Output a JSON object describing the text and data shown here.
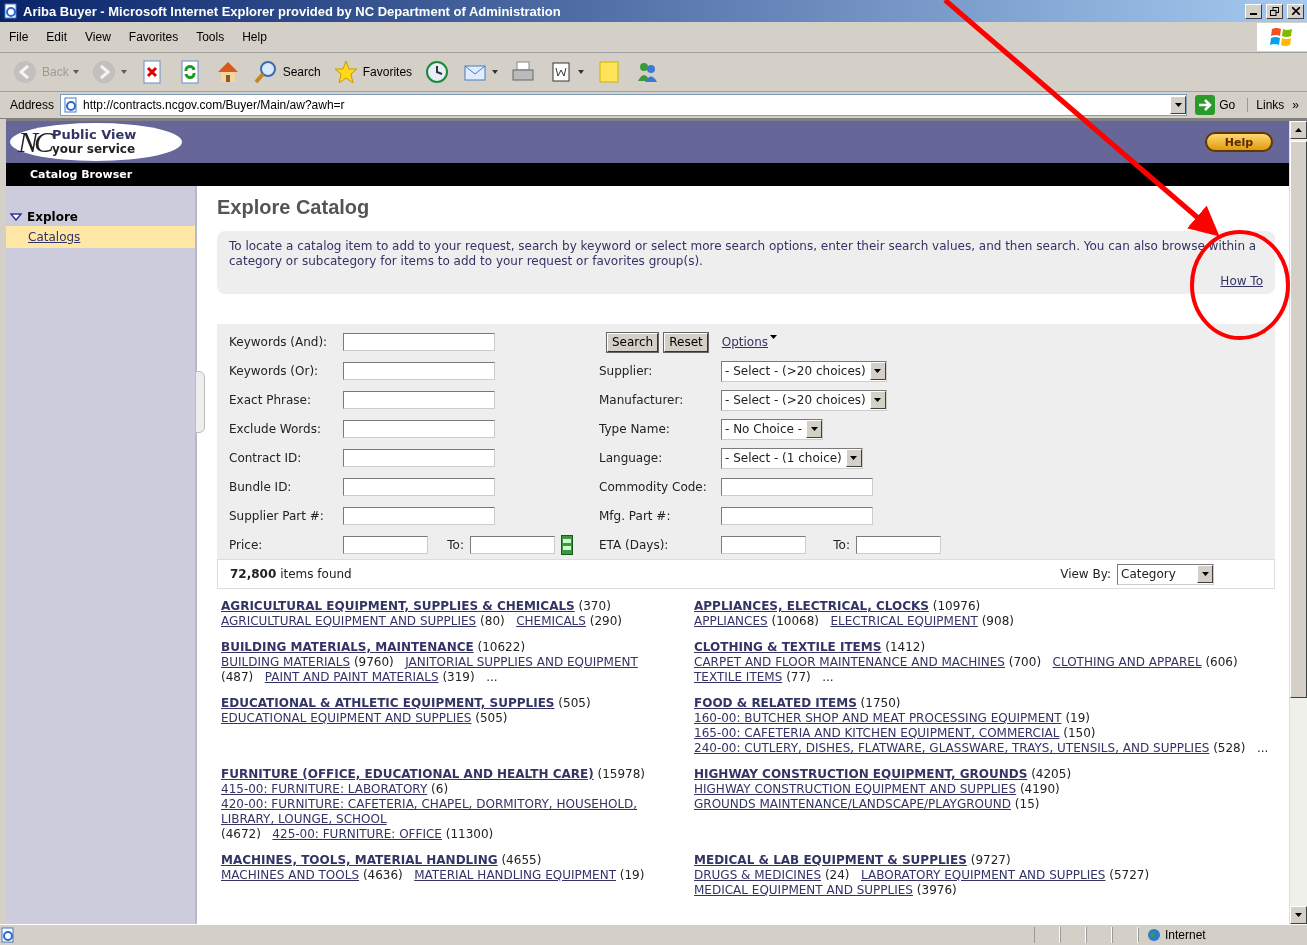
{
  "window": {
    "title": "Ariba Buyer - Microsoft Internet Explorer provided by NC Department of Administration"
  },
  "menu": [
    "File",
    "Edit",
    "View",
    "Favorites",
    "Tools",
    "Help"
  ],
  "toolbar": [
    {
      "kind": "back",
      "label": "Back",
      "disabled": true,
      "dropdown": true
    },
    {
      "kind": "forward",
      "disabled": true,
      "dropdown": true
    },
    {
      "kind": "stop",
      "disabled": false,
      "dropdown": false
    },
    {
      "kind": "refresh",
      "disabled": false,
      "dropdown": false
    },
    {
      "kind": "home",
      "disabled": false,
      "dropdown": false
    },
    {
      "kind": "search",
      "label": "Search",
      "disabled": false,
      "dropdown": false
    },
    {
      "kind": "favorites",
      "label": "Favorites",
      "disabled": false,
      "dropdown": false
    },
    {
      "kind": "history",
      "disabled": false,
      "dropdown": false
    },
    {
      "kind": "mail",
      "disabled": false,
      "dropdown": true
    },
    {
      "kind": "print",
      "disabled": false,
      "dropdown": false
    },
    {
      "kind": "edit",
      "disabled": false,
      "dropdown": true
    },
    {
      "kind": "note",
      "disabled": false,
      "dropdown": false
    },
    {
      "kind": "messenger",
      "disabled": false,
      "dropdown": false
    }
  ],
  "address": {
    "label": "Address",
    "url": "http://contracts.ncgov.com/Buyer/Main/aw?awh=r",
    "go": "Go",
    "links": "Links",
    "more": "»"
  },
  "header": {
    "logo_letters": "NC",
    "logo_title": "Public View",
    "logo_subtitle": "your service",
    "help": "Help",
    "nav_title": "Catalog Browser"
  },
  "sidebar": {
    "section": "Explore",
    "expanded": true,
    "items": [
      {
        "label": "Catalogs",
        "selected": true
      }
    ]
  },
  "main": {
    "title": "Explore Catalog",
    "intro": "To locate a catalog item to add to your request, search by keyword or select more search options, enter their search values, and then search. You can also browse within a category or subcategory for items to add to your request or favorites group(s).",
    "how_to": "How To"
  },
  "search": {
    "left": [
      {
        "label": "Keywords (And):"
      },
      {
        "label": "Keywords (Or):"
      },
      {
        "label": "Exact Phrase:"
      },
      {
        "label": "Exclude Words:"
      },
      {
        "label": "Contract ID:"
      },
      {
        "label": "Bundle ID:"
      },
      {
        "label": "Supplier Part #:"
      }
    ],
    "price": {
      "label": "Price:",
      "to": "To:"
    },
    "buttons": [
      "Search",
      "Reset"
    ],
    "options": "Options",
    "right": [
      {
        "kind": "select",
        "label": "Supplier:",
        "value": "- Select - (>20 choices)"
      },
      {
        "kind": "select",
        "label": "Manufacturer:",
        "value": "- Select - (>20 choices)"
      },
      {
        "kind": "select",
        "label": "Type Name:",
        "value": "- No Choice -"
      },
      {
        "kind": "select",
        "label": "Language:",
        "value": "- Select - (1 choice)"
      },
      {
        "kind": "text",
        "label": "Commodity Code:"
      },
      {
        "kind": "text",
        "label": "Mfg. Part #:"
      }
    ],
    "eta": {
      "label": "ETA (Days):",
      "to": "To:"
    }
  },
  "results": {
    "count": "72,800",
    "label": "items found",
    "view_by": "View By:",
    "view_value": "Category"
  },
  "categories": [
    {
      "title": "AGRICULTURAL EQUIPMENT, SUPPLIES & CHEMICALS",
      "count": "(370)",
      "subs": [
        {
          "label": "AGRICULTURAL EQUIPMENT AND SUPPLIES",
          "count": "(80)"
        },
        {
          "label": "CHEMICALS",
          "count": "(290)"
        }
      ]
    },
    {
      "title": "APPLIANCES, ELECTRICAL, CLOCKS",
      "count": "(10976)",
      "subs": [
        {
          "label": "APPLIANCES",
          "count": "(10068)"
        },
        {
          "label": "ELECTRICAL EQUIPMENT",
          "count": "(908)"
        }
      ]
    },
    {
      "title": "BUILDING MATERIALS, MAINTENANCE",
      "count": "(10622)",
      "more": "...",
      "subs": [
        {
          "label": "BUILDING MATERIALS",
          "count": "(9760)"
        },
        {
          "label": "JANITORIAL SUPPLIES AND EQUIPMENT",
          "count": "(487)"
        },
        {
          "label": "PAINT AND PAINT MATERIALS",
          "count": "(319)"
        }
      ]
    },
    {
      "title": "CLOTHING & TEXTILE ITEMS",
      "count": "(1412)",
      "more": "...",
      "subs": [
        {
          "label": "CARPET AND FLOOR MAINTENANCE AND MACHINES",
          "count": "(700)"
        },
        {
          "label": "CLOTHING AND APPAREL",
          "count": "(606)"
        },
        {
          "label": "TEXTILE ITEMS",
          "count": "(77)"
        }
      ]
    },
    {
      "title": "EDUCATIONAL & ATHLETIC EQUIPMENT, SUPPLIES",
      "count": "(505)",
      "subs": [
        {
          "label": "EDUCATIONAL EQUIPMENT AND SUPPLIES",
          "count": "(505)"
        }
      ]
    },
    {
      "title": "FOOD & RELATED ITEMS",
      "count": "(1750)",
      "more": "...",
      "subs": [
        {
          "label": "160-00: BUTCHER SHOP AND MEAT PROCESSING EQUIPMENT",
          "count": "(19)"
        },
        {
          "label": "165-00: CAFETERIA AND KITCHEN EQUIPMENT, COMMERCIAL",
          "count": "(150)"
        },
        {
          "label": "240-00: CUTLERY, DISHES, FLATWARE, GLASSWARE, TRAYS, UTENSILS, AND SUPPLIES",
          "count": "(528)"
        }
      ]
    },
    {
      "title": "FURNITURE (OFFICE, EDUCATIONAL AND HEALTH CARE)",
      "count": "(15978)",
      "subs": [
        {
          "label": "415-00: FURNITURE: LABORATORY",
          "count": "(6)"
        },
        {
          "label": "420-00: FURNITURE: CAFETERIA, CHAPEL, DORMITORY, HOUSEHOLD, LIBRARY, LOUNGE, SCHOOL",
          "count": "(4672)"
        },
        {
          "label": "425-00: FURNITURE: OFFICE",
          "count": "(11300)"
        }
      ]
    },
    {
      "title": "HIGHWAY CONSTRUCTION EQUIPMENT, GROUNDS",
      "count": "(4205)",
      "subs": [
        {
          "label": "HIGHWAY CONSTRUCTION EQUIPMENT AND SUPPLIES",
          "count": "(4190)"
        },
        {
          "label": "GROUNDS MAINTENANCE/LANDSCAPE/PLAYGROUND",
          "count": "(15)"
        }
      ]
    },
    {
      "title": "MACHINES, TOOLS, MATERIAL HANDLING",
      "count": "(4655)",
      "subs": [
        {
          "label": "MACHINES AND TOOLS",
          "count": "(4636)"
        },
        {
          "label": "MATERIAL HANDLING EQUIPMENT",
          "count": "(19)"
        }
      ]
    },
    {
      "title": "MEDICAL & LAB EQUIPMENT & SUPPLIES",
      "count": "(9727)",
      "subs": [
        {
          "label": "DRUGS & MEDICINES",
          "count": "(24)"
        },
        {
          "label": "LABORATORY EQUIPMENT AND SUPPLIES",
          "count": "(5727)"
        },
        {
          "label": "MEDICAL EQUIPMENT AND SUPPLIES",
          "count": "(3976)"
        }
      ]
    }
  ],
  "status_bar": {
    "zone": "Internet"
  }
}
